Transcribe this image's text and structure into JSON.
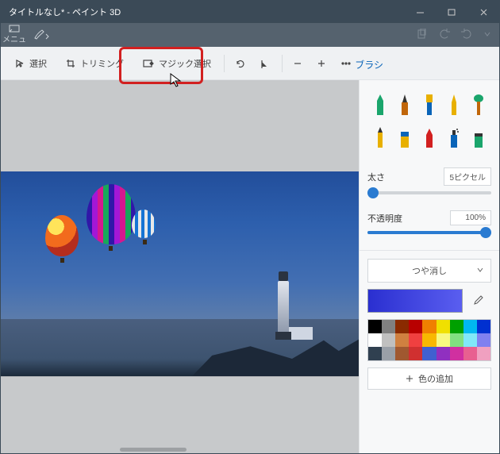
{
  "window": {
    "title": "タイトルなし* - ペイント 3D"
  },
  "ribbon": {
    "menu_label": "メニュー"
  },
  "toolbar": {
    "select": "選択",
    "trim": "トリミング",
    "magic_select": "マジック選択",
    "brush_panel_title": "ブラシ"
  },
  "panel": {
    "thickness_label": "太さ",
    "thickness_value": "5ピクセル",
    "opacity_label": "不透明度",
    "opacity_value": "100%",
    "finish_label": "つや消し",
    "add_color_label": "色の追加",
    "current_color": "#2a2fd0",
    "palette": [
      "#000000",
      "#808080",
      "#8a2a00",
      "#b80000",
      "#f08000",
      "#f0e000",
      "#00a000",
      "#00b8f0",
      "#0030d0",
      "#ffffff",
      "#c0c0c0",
      "#d08040",
      "#f04040",
      "#f8b800",
      "#f8f880",
      "#80e080",
      "#80e8f8",
      "#8080f0",
      "#304050",
      "#9aa0a8",
      "#a05830",
      "#d03030",
      "#4060d0",
      "#9030c0",
      "#d030a0",
      "#e86090",
      "#f0a0c0"
    ]
  }
}
